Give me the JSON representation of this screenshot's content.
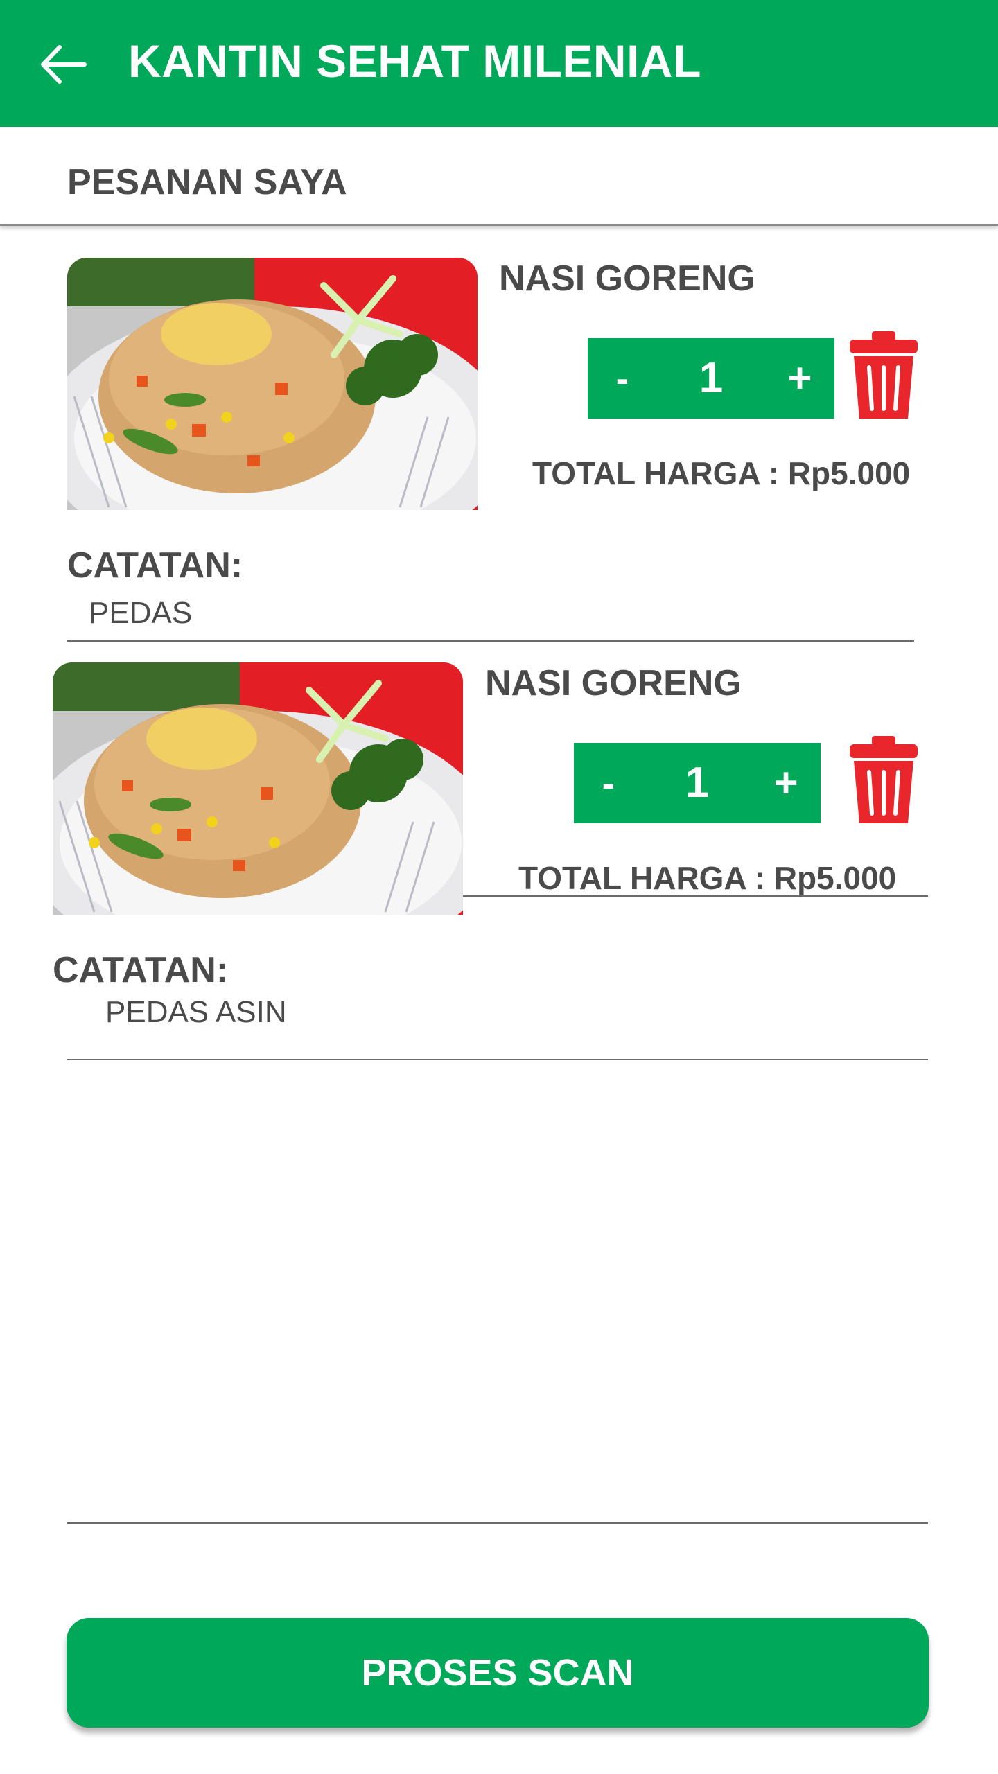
{
  "appbar": {
    "title": "KANTIN SEHAT MILENIAL",
    "back_icon": "arrow-left-icon"
  },
  "section": {
    "title": "PESANAN SAYA"
  },
  "orders": [
    {
      "name": "NASI GORENG",
      "image": "nasi-goreng-photo",
      "quantity": "1",
      "minus_label": "-",
      "plus_label": "+",
      "total": "TOTAL HARGA : Rp5.000",
      "note_label": "CATATAN:",
      "note": "PEDAS",
      "delete_icon": "trash-icon"
    },
    {
      "name": "NASI GORENG",
      "image": "nasi-goreng-photo",
      "quantity": "1",
      "minus_label": "-",
      "plus_label": "+",
      "total": "TOTAL HARGA : Rp5.000",
      "note_label": "CATATAN:",
      "note": "PEDAS ASIN",
      "delete_icon": "trash-icon"
    }
  ],
  "footer": {
    "button_label": "PROSES SCAN"
  },
  "colors": {
    "primary": "#00a859",
    "danger": "#e8262b",
    "text": "#4a4a4a"
  }
}
